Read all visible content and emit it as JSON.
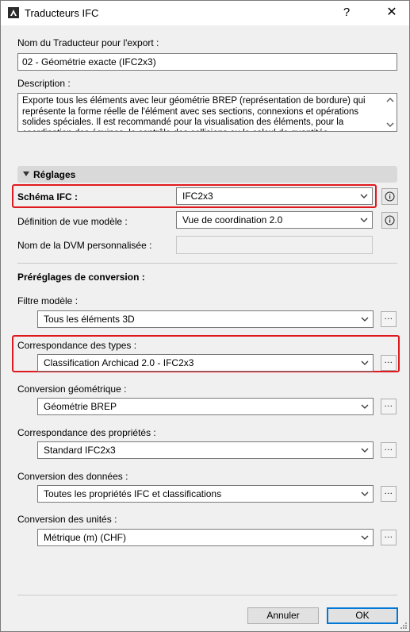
{
  "window": {
    "title": "Traducteurs IFC",
    "help_label": "?",
    "close_label": "✕"
  },
  "translator_name": {
    "label": "Nom du Traducteur pour l'export :",
    "value": "02 - Géométrie exacte (IFC2x3)"
  },
  "description": {
    "label": "Description :",
    "text": "Exporte tous les éléments avec leur géométrie BREP (représentation de bordure) qui représente la forme réelle de l'élément avec ses sections, connexions et opérations solides spéciales. Il est recommandé pour la visualisation des éléments, pour la coordination des équipes, le contrôle des collisions ou le calcul de quantités."
  },
  "settings": {
    "section_title": "Réglages",
    "schema": {
      "label": "Schéma IFC :",
      "value": "IFC2x3"
    },
    "mvd": {
      "label": "Définition de vue modèle :",
      "value": "Vue de coordination 2.0"
    },
    "custom_mvd": {
      "label": "Nom de la DVM personnalisée :",
      "value": ""
    }
  },
  "presets": {
    "title": "Préréglages de conversion :",
    "items": [
      {
        "label": "Filtre modèle :",
        "value": "Tous les éléments 3D"
      },
      {
        "label": "Correspondance des types :",
        "value": "Classification Archicad 2.0 - IFC2x3"
      },
      {
        "label": "Conversion géométrique :",
        "value": "Géométrie BREP"
      },
      {
        "label": "Correspondance des propriétés :",
        "value": "Standard IFC2x3"
      },
      {
        "label": "Conversion des données :",
        "value": "Toutes les propriétés IFC et classifications"
      },
      {
        "label": "Conversion des unités :",
        "value": "Métrique (m) (CHF)"
      }
    ],
    "browse_label": "..."
  },
  "footer": {
    "cancel_label": "Annuler",
    "ok_label": "OK"
  },
  "colors": {
    "highlight": "#e0191f",
    "default_button_border": "#0078d7"
  }
}
